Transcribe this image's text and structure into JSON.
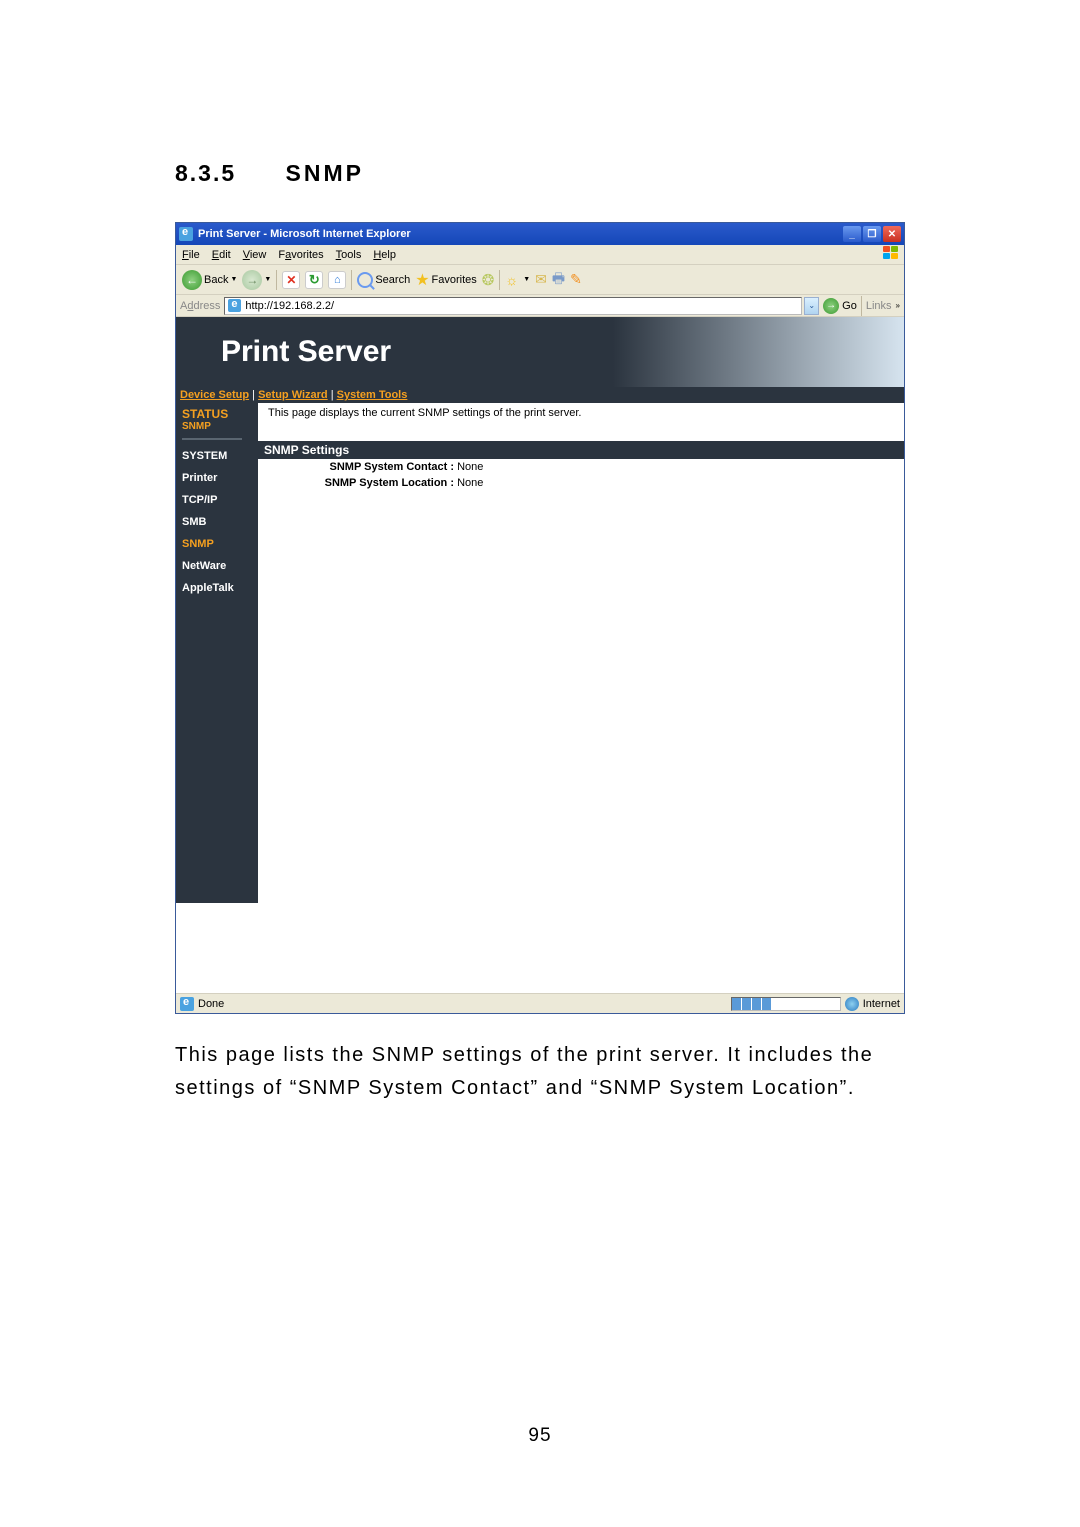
{
  "heading": {
    "number": "8.3.5",
    "title": "SNMP"
  },
  "browser": {
    "title": "Print Server - Microsoft Internet Explorer",
    "menus": {
      "file": "File",
      "edit": "Edit",
      "view": "View",
      "favorites": "Favorites",
      "tools": "Tools",
      "help": "Help"
    },
    "toolbar": {
      "back": "Back",
      "search": "Search",
      "favorites": "Favorites"
    },
    "address": {
      "label": "Address",
      "url": "http://192.168.2.2/",
      "go": "Go",
      "links": "Links"
    },
    "status": {
      "done": "Done",
      "zone": "Internet"
    }
  },
  "page": {
    "banner": "Print Server",
    "topnav": {
      "device": "Device Setup",
      "wizard": "Setup Wizard",
      "system": "System Tools"
    },
    "sidebar": {
      "header1": "STATUS",
      "header2": "SNMP",
      "items": {
        "system": "SYSTEM",
        "printer": "Printer",
        "tcpip": "TCP/IP",
        "smb": "SMB",
        "snmp": "SNMP",
        "netware": "NetWare",
        "appletalk": "AppleTalk"
      }
    },
    "desc": "This page displays the current SNMP settings of the print server.",
    "section": "SNMP Settings",
    "rows": {
      "contact": {
        "k": "SNMP System Contact :",
        "v": "None"
      },
      "location": {
        "k": "SNMP System Location :",
        "v": "None"
      }
    }
  },
  "caption": "This page lists the SNMP settings of the print server. It includes the settings of “SNMP System Contact” and “SNMP System Location”.",
  "pagenum": "95"
}
